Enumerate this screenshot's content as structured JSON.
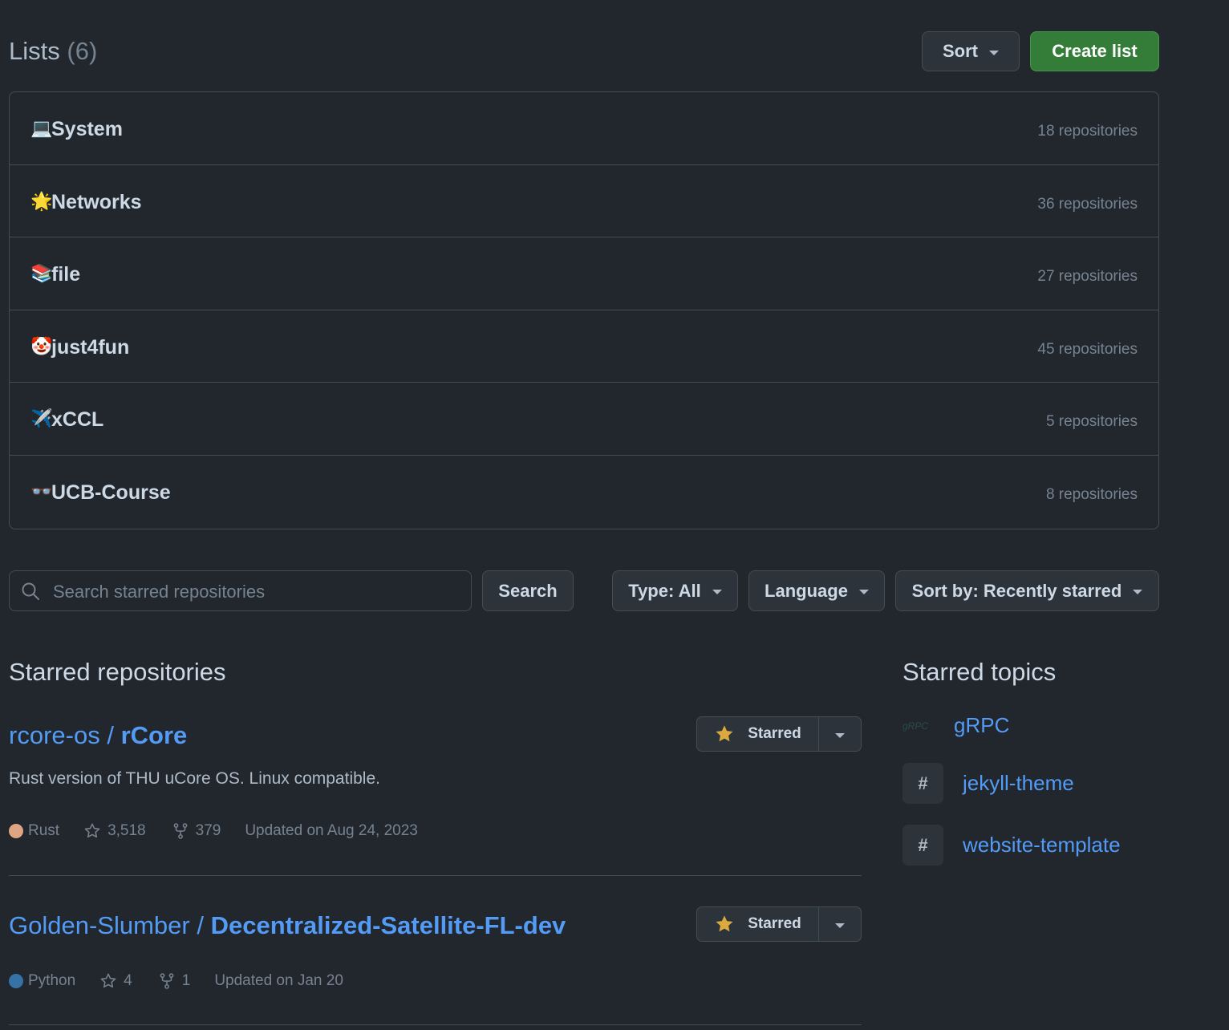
{
  "lists": {
    "title": "Lists",
    "count": "(6)",
    "sort_label": "Sort",
    "create_label": "Create list",
    "items": [
      {
        "emoji": "💻",
        "name": "System",
        "count": "18 repositories"
      },
      {
        "emoji": "🌟",
        "name": "Networks",
        "count": "36 repositories"
      },
      {
        "emoji": "📚",
        "name": "file",
        "count": "27 repositories"
      },
      {
        "emoji": "🤡",
        "name": "just4fun",
        "count": "45 repositories"
      },
      {
        "emoji": "✈️",
        "name": "xCCL",
        "count": "5 repositories"
      },
      {
        "emoji": "👓",
        "name": "UCB-Course",
        "count": "8 repositories"
      }
    ]
  },
  "filters": {
    "search_placeholder": "Search starred repositories",
    "search_value": "",
    "search_button": "Search",
    "type_label": "Type: All",
    "language_label": "Language",
    "sortby_label": "Sort by: Recently starred"
  },
  "starred": {
    "title": "Starred repositories",
    "repos": [
      {
        "owner": "rcore-os",
        "name": "rCore",
        "description": "Rust version of THU uCore OS. Linux compatible.",
        "language": "Rust",
        "language_color": "#dea584",
        "stars": "3,518",
        "forks": "379",
        "updated": "Updated on Aug 24, 2023",
        "star_label": "Starred"
      },
      {
        "owner": "Golden-Slumber",
        "name": "Decentralized-Satellite-FL-dev",
        "description": "",
        "language": "Python",
        "language_color": "#3572A5",
        "stars": "4",
        "forks": "1",
        "updated": "Updated on Jan 20",
        "star_label": "Starred"
      }
    ]
  },
  "topics": {
    "title": "Starred topics",
    "items": [
      {
        "icon": "grpc-logo",
        "logo_text": "gRPC",
        "name": "gRPC"
      },
      {
        "icon": "hash",
        "name": "jekyll-theme"
      },
      {
        "icon": "hash",
        "name": "website-template"
      }
    ]
  },
  "colors": {
    "background": "#22272e",
    "border": "#444c56",
    "link": "#539bf5",
    "create_button": "#347d39",
    "star": "#daaa3f"
  }
}
